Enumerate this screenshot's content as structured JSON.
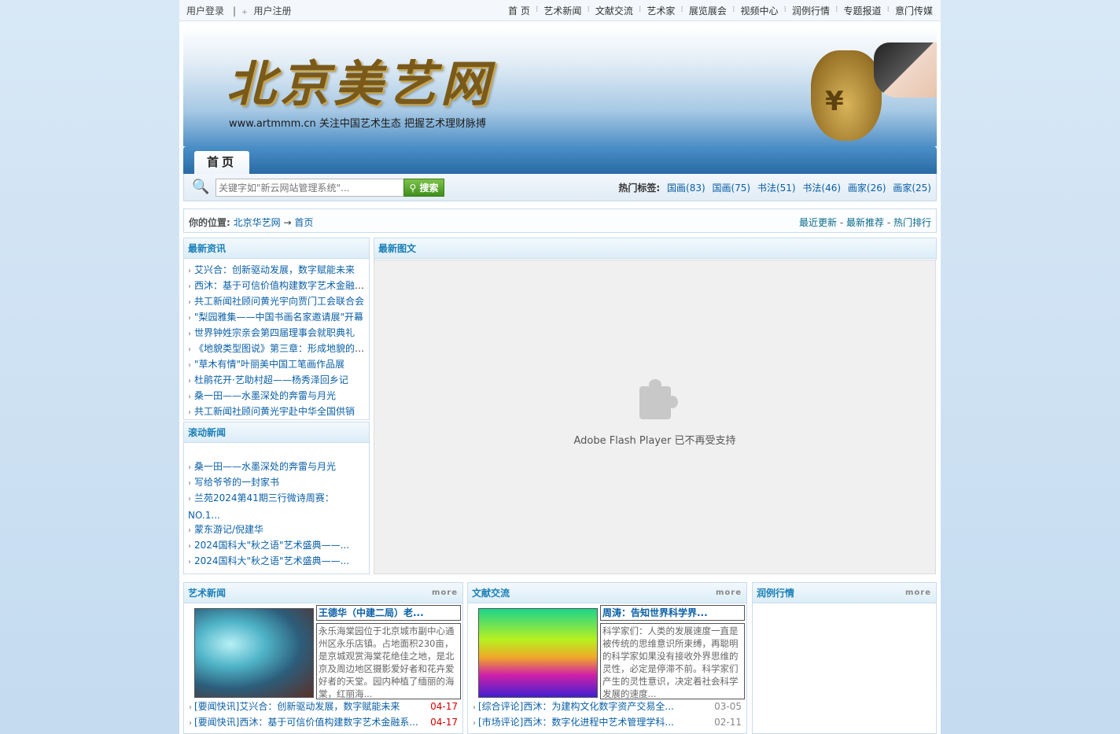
{
  "topbar": {
    "login": "用户登录",
    "register": "用户注册",
    "nav": [
      "首 页",
      "艺术新闻",
      "文献交流",
      "艺术家",
      "展览展会",
      "视频中心",
      "润例行情",
      "专题报道",
      "意门传媒"
    ]
  },
  "banner": {
    "logo_text": "北京美艺网",
    "slogan": "www.artmmm.cn 关注中国艺术生态 把握艺术理财脉搏",
    "bag_symbol": "¥"
  },
  "menu": {
    "home_tab": "首页"
  },
  "search": {
    "placeholder": "关键字如\"新云网站管理系统\"...",
    "button": "搜索",
    "hot_label": "热门标签:",
    "tags": [
      "国画(83)",
      "国画(75)",
      "书法(51)",
      "书法(46)",
      "画家(26)",
      "画家(25)"
    ]
  },
  "location": {
    "label": "你的位置:",
    "site": "北京华艺网",
    "arrow": "→",
    "page": "首页",
    "links": [
      "最近更新",
      "最新推荐",
      "热门排行"
    ]
  },
  "latest_news": {
    "title": "最新资讯",
    "items": [
      "艾兴合：创新驱动发展，数字赋能未来",
      "西沐：基于可信价值构建数字艺术金融系统",
      "共工新闻社顾问黄光宇向贾门工会联合会",
      "\"梨园雅集——中国书画名家邀请展\"开幕",
      "世界钟姓宗亲会第四届理事会就职典礼",
      "《地貌类型图说》第三章：形成地貌的作用",
      "\"草木有情\"叶丽美中国工笔画作品展",
      "杜鹃花开·艺助村超——杨秀泽回乡记",
      "桑一田——水墨深处的奔雷与月光",
      "共工新闻社顾问黄光宇赴中华全国供销"
    ]
  },
  "scroll_news": {
    "title": "滚动新闻",
    "items": [
      "桑一田——水墨深处的奔雷与月光",
      "写给爷爷的一封家书",
      "兰苑2024第41期三行微诗周赛：NO.1...",
      "蒙东游记/倪建华",
      "2024国科大\"秋之语\"艺术盛典——...",
      "2024国科大\"秋之语\"艺术盛典——..."
    ]
  },
  "featured": {
    "title": "最新图文",
    "flash_message": "Adobe Flash Player 已不再受支持"
  },
  "art_news": {
    "title": "艺术新闻",
    "more": "more",
    "headline": "王德华（中建二局）老...",
    "desc": "永乐海棠园位于北京城市副中心通州区永乐店镇。占地面积230亩，是京城观赏海棠花绝佳之地，是北京及周边地区摄影爱好者和花卉爱好者的天堂。园内种植了缅丽的海棠，红丽海...",
    "lines": [
      {
        "text": "[要闻快讯]艾兴合：创新驱动发展，数字赋能未来",
        "date": "04-17"
      },
      {
        "text": "[要闻快讯]西沐：基于可信价值构建数字艺术金融系...",
        "date": "04-17"
      }
    ]
  },
  "literature": {
    "title": "文献交流",
    "more": "more",
    "headline": "周涛：告知世界科学界...",
    "desc": "科学家们：人类的发展速度一直是被传统的思维意识所束缚，再聪明的科学家如果没有接收外界思维的灵性，必定是停滞不前。科学家们产生的灵性意识，决定着社会科学发展的速度...",
    "lines": [
      {
        "text": "[综合评论]西沐：为建构文化数字资产交易全...",
        "date": "03-05"
      },
      {
        "text": "[市场评论]西沐：数字化进程中艺术管理学科...",
        "date": "02-11"
      }
    ]
  },
  "pricing": {
    "title": "润例行情",
    "more": "more"
  },
  "colors": {
    "link": "#0a5fa6",
    "red_date": "#d40000",
    "grey_date": "#888888",
    "header_text": "#1a7fb8"
  }
}
